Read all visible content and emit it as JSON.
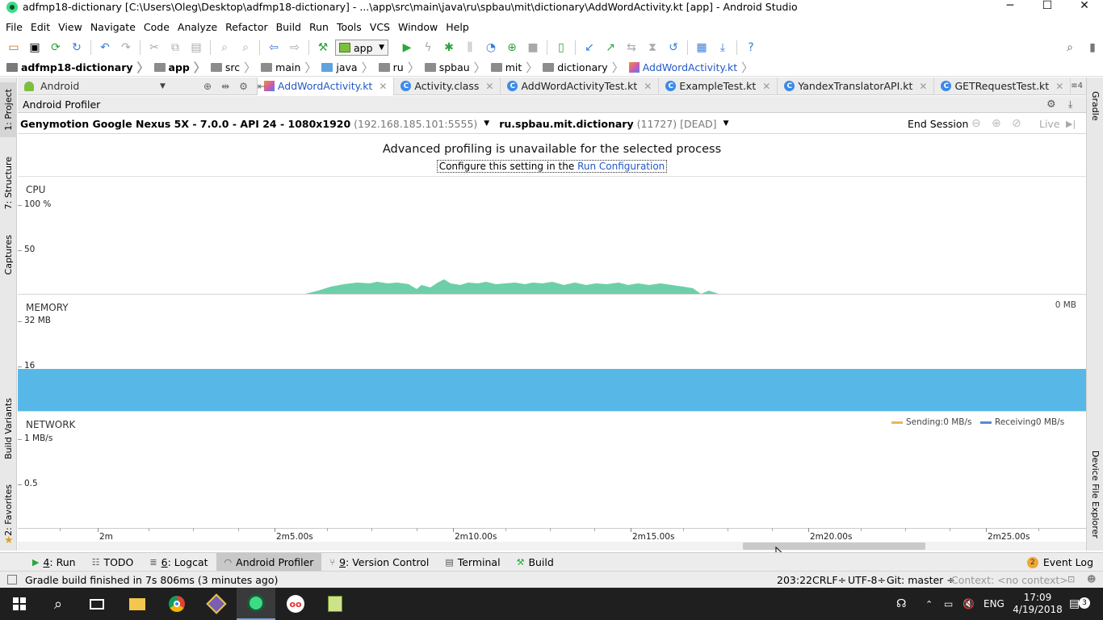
{
  "window": {
    "title": "adfmp18-dictionary [C:\\Users\\Oleg\\Desktop\\adfmp18-dictionary] - ...\\app\\src\\main\\java\\ru\\spbau\\mit\\dictionary\\AddWordActivity.kt [app] - Android Studio",
    "minimize": "─",
    "maximize": "☐",
    "close": "✕"
  },
  "menu": [
    "File",
    "Edit",
    "View",
    "Navigate",
    "Code",
    "Analyze",
    "Refactor",
    "Build",
    "Run",
    "Tools",
    "VCS",
    "Window",
    "Help"
  ],
  "toolbar": {
    "run_config": "app",
    "icons": [
      "open-icon",
      "save-icon",
      "sync-icon",
      "refresh-icon",
      "undo-icon",
      "redo-icon",
      "cut-icon",
      "copy-icon",
      "paste-icon",
      "find-icon",
      "replace-icon",
      "back-icon",
      "forward-icon",
      "make-icon",
      "run-icon",
      "apply-changes-icon",
      "debug-icon",
      "coverage-icon",
      "profile-icon",
      "attach-debugger-icon",
      "stop-icon",
      "avd-manager-icon",
      "sdk-manager-icon",
      "vcs-update-icon",
      "vcs-commit-icon",
      "vcs-compare-icon",
      "vcs-history-icon",
      "vcs-revert-icon",
      "project-structure-icon",
      "device-monitor-icon",
      "help-icon",
      "search-everywhere-icon"
    ]
  },
  "breadcrumb": [
    "adfmp18-dictionary",
    "app",
    "src",
    "main",
    "java",
    "ru",
    "spbau",
    "mit",
    "dictionary",
    "AddWordActivity.kt"
  ],
  "project_view": {
    "label": "Android"
  },
  "editor_tabs": [
    {
      "label": "AddWordActivity.kt",
      "active": true
    },
    {
      "label": "Activity.class",
      "active": false
    },
    {
      "label": "AddWordActivityTest.kt",
      "active": false
    },
    {
      "label": "ExampleTest.kt",
      "active": false
    },
    {
      "label": "YandexTranslatorAPI.kt",
      "active": false
    },
    {
      "label": "GETRequestTest.kt",
      "active": false
    }
  ],
  "tabs_overflow": "≡4",
  "left_strip": [
    "1: Project",
    "7: Structure",
    "Captures",
    "Build Variants",
    "2: Favorites"
  ],
  "right_strip": [
    "Gradle",
    "Device File Explorer"
  ],
  "profiler": {
    "title": "Android Profiler",
    "device": "Genymotion Google Nexus 5X - 7.0.0 - API 24 - 1080x1920",
    "device_ip": "(192.168.185.101:5555)",
    "process": "ru.spbau.mit.dictionary",
    "process_status": "(11727) [DEAD]",
    "end_session": "End Session",
    "live": "Live",
    "banner_title": "Advanced profiling is unavailable for the selected process",
    "banner_text": "Configure this setting in the ",
    "banner_link": "Run Configuration",
    "cpu": {
      "label": "CPU",
      "y_max": "100 %",
      "y_mid": "50"
    },
    "memory": {
      "label": "MEMORY",
      "y_max": "32 MB",
      "y_mid": "16",
      "current": "0 MB"
    },
    "network": {
      "label": "NETWORK",
      "y_max": "1 MB/s",
      "y_mid": "0.5",
      "sending": "Sending:0 MB/s",
      "receiving": "Receiving0 MB/s"
    },
    "time_ticks": [
      "2m",
      "2m5.00s",
      "2m10.00s",
      "2m15.00s",
      "2m20.00s",
      "2m25.00s"
    ],
    "colors": {
      "cpu": "#6dcfa8",
      "memory": "#57b8e8",
      "sending": "#f0b060",
      "receiving": "#5a87d8"
    }
  },
  "tool_tabs": [
    {
      "num": "4",
      "label": ": Run",
      "icon": "run-icon"
    },
    {
      "num": "",
      "label": "TODO",
      "icon": "todo-icon"
    },
    {
      "num": "6",
      "label": ": Logcat",
      "icon": "logcat-icon"
    },
    {
      "num": "",
      "label": "Android Profiler",
      "icon": "profiler-icon",
      "active": true
    },
    {
      "num": "9",
      "label": ": Version Control",
      "icon": "vcs-icon"
    },
    {
      "num": "",
      "label": "Terminal",
      "icon": "terminal-icon"
    },
    {
      "num": "",
      "label": "Build",
      "icon": "build-icon"
    }
  ],
  "event_log": {
    "count": "2",
    "label": "Event Log"
  },
  "status": {
    "message": "Gradle build finished in 7s 806ms (3 minutes ago)",
    "position": "203:22",
    "line_sep": "CRLF÷",
    "encoding": "UTF-8÷",
    "git": "Git: master ÷",
    "context": "Context: <no context>"
  },
  "taskbar": {
    "time": "17:09",
    "date": "4/19/2018",
    "lang": "ENG",
    "notifications": "3"
  }
}
